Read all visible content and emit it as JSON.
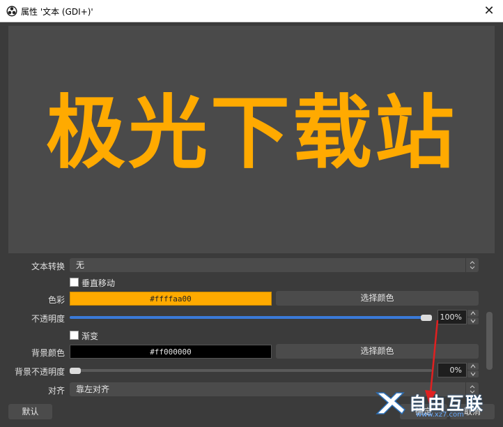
{
  "window": {
    "title": "属性 '文本 (GDI+)'",
    "close_label": "✕"
  },
  "preview": {
    "text": "极光下载站",
    "text_color": "#ffaa00",
    "bg_color": "#4a4a4a"
  },
  "props": {
    "transform_label": "文本转换",
    "transform_value": "无",
    "vertical_label": "垂直移动",
    "color_label": "色彩",
    "color_value": "#ffffaa00",
    "color_button": "选择颜色",
    "opacity_label": "不透明度",
    "opacity_value": "100%",
    "opacity_fraction": 1.0,
    "gradient_label": "渐变",
    "bg_color_label": "背景颜色",
    "bg_color_value": "#ff000000",
    "bg_color_button": "选择颜色",
    "bg_opacity_label": "背景不透明度",
    "bg_opacity_value": "0%",
    "bg_opacity_fraction": 0.0,
    "align_label": "对齐",
    "align_value": "靠左对齐"
  },
  "footer": {
    "default_button": "默认",
    "ok_button": "确定",
    "cancel_button": "取消"
  },
  "watermark": {
    "text": "自由互联",
    "sub": "www.xz7.com"
  },
  "colors": {
    "accent": "#3a7ad9",
    "arrow": "#e02020"
  }
}
